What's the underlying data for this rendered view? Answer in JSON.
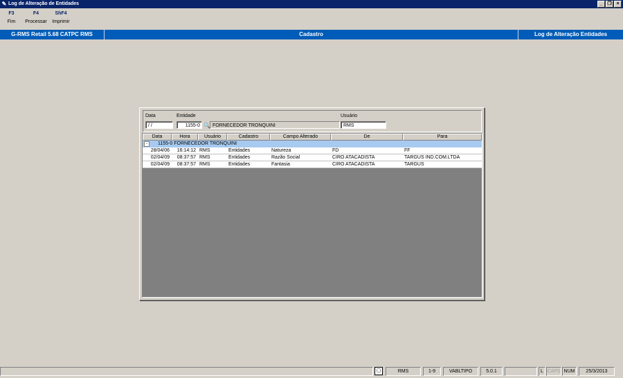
{
  "window": {
    "title": "Log de Alteração de Entidades",
    "icon": "pencil-icon",
    "buttons": [
      "minimize",
      "restore",
      "close"
    ]
  },
  "fkeys": [
    {
      "key": "F3",
      "label": "Fim"
    },
    {
      "key": "F4",
      "label": "Processar"
    },
    {
      "key": "ShF4",
      "label": "Imprimir"
    }
  ],
  "header": {
    "left": "G-RMS Retail 5.68 CATPC RMS",
    "center": "Cadastro",
    "right": "Log de Alteração Entidades"
  },
  "filters": {
    "data_label": "Data",
    "data_value": " / /",
    "entidade_label": "Entidade",
    "entidade_code": "1155-0",
    "entidade_name": "FORNECEDOR TRONQUINI",
    "usuario_label": "Usuário",
    "usuario_value": "RMS"
  },
  "grid": {
    "columns": [
      "Data",
      "Hora",
      "Usuário",
      "Cadastro",
      "Campo Alterado",
      "De",
      "Para"
    ],
    "group": {
      "toggle": "-",
      "label": "1155-0  FORNECEDOR TRONQUINI"
    },
    "rows": [
      {
        "data": "28/04/06",
        "hora": "16:14:12",
        "usuario": "RMS",
        "cadastro": "Entidades",
        "campo": "Natureza",
        "de": "FD",
        "para": "FF"
      },
      {
        "data": "02/04/09",
        "hora": "08:37:57",
        "usuario": "RMS",
        "cadastro": "Entidades",
        "campo": "Razão Social",
        "de": "CIRO ATACADISTA",
        "para": "TARGUS IND.COM.LTDA"
      },
      {
        "data": "02/04/09",
        "hora": "08:37:57",
        "usuario": "RMS",
        "cadastro": "Entidades",
        "campo": "Fantasia",
        "de": "CIRO ATACADISTA",
        "para": "TARGUS"
      }
    ]
  },
  "status": {
    "user": "RMS",
    "page": "1-9",
    "table": "VABLTIPO",
    "version": "5.0.1",
    "blank": "",
    "l": "L",
    "caps": "CAPS",
    "num": "NUM",
    "date": "25/3/2013"
  }
}
